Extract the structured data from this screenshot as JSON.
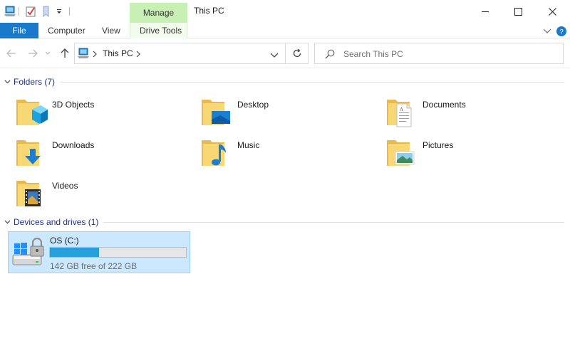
{
  "window": {
    "title": "This PC",
    "contextual_tab": "Manage"
  },
  "ribbon": {
    "tabs": [
      "File",
      "Computer",
      "View",
      "Drive Tools"
    ]
  },
  "address": {
    "path": "This PC",
    "search_placeholder": "Search This PC"
  },
  "folders": {
    "header": "Folders (7)",
    "items": [
      {
        "label": "3D Objects",
        "icon": "3d-objects-folder-icon"
      },
      {
        "label": "Desktop",
        "icon": "desktop-folder-icon"
      },
      {
        "label": "Documents",
        "icon": "documents-folder-icon"
      },
      {
        "label": "Downloads",
        "icon": "downloads-folder-icon"
      },
      {
        "label": "Music",
        "icon": "music-folder-icon"
      },
      {
        "label": "Pictures",
        "icon": "pictures-folder-icon"
      },
      {
        "label": "Videos",
        "icon": "videos-folder-icon"
      }
    ]
  },
  "devices": {
    "header": "Devices and drives (1)",
    "drive": {
      "name": "OS (C:)",
      "free_text": "142 GB free of 222 GB",
      "used_fraction": 0.36
    }
  },
  "colors": {
    "file_tab": "#1979ca",
    "manage_tab": "#c8efb4",
    "group_header": "#1e3287",
    "selection": "#cce8ff",
    "drive_fill": "#26a0da"
  }
}
